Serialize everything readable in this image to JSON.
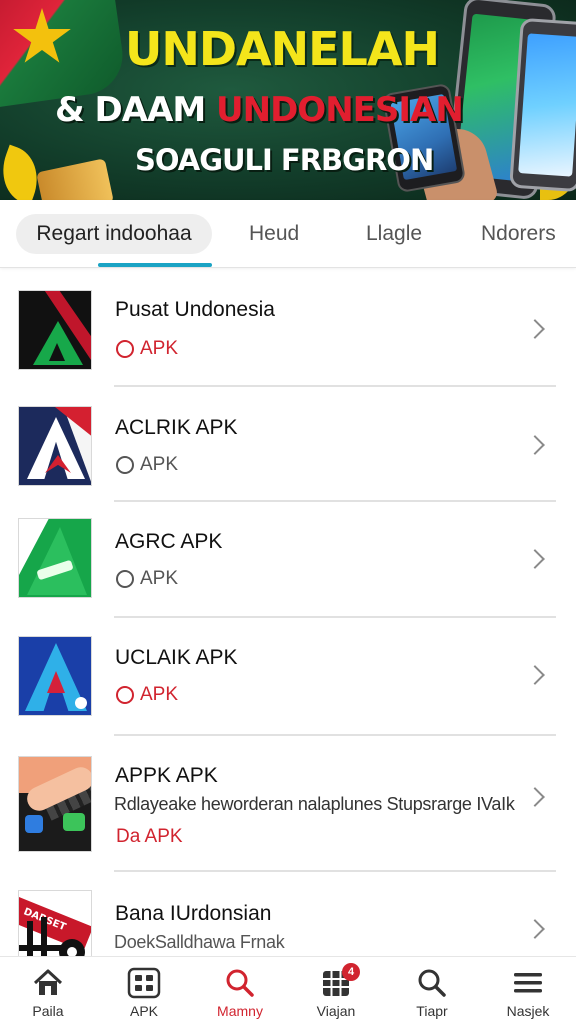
{
  "banner": {
    "title": "UNDANELAH",
    "line2_white": "& DAAM",
    "line2_red": " UNDONESIAN",
    "line3": "SOAGULI FRBGRON"
  },
  "tabs": [
    {
      "label": "Regart indoohaa",
      "active": true
    },
    {
      "label": "Heud",
      "active": false
    },
    {
      "label": "Llagle",
      "active": false
    },
    {
      "label": "Ndorers",
      "active": false
    }
  ],
  "accent_color": "#1aa3c4",
  "badge_red_color": "#d1242f",
  "items": [
    {
      "name": "Pusat Undonesia",
      "badge": "APK",
      "badge_style": "red",
      "icon": "red-green-triangle-logo"
    },
    {
      "name": "ACLRIK APK",
      "badge": "APK",
      "badge_style": "gray",
      "icon": "navy-red-a-logo"
    },
    {
      "name": "AGRC APK",
      "badge": "APK",
      "badge_style": "gray",
      "icon": "green-triangle-logo"
    },
    {
      "name": "UCLAIK APK",
      "badge": "APK",
      "badge_style": "red",
      "icon": "blue-a-logo"
    },
    {
      "name": "APPK APK",
      "desc": "Rdlayeake heworderan nalaplunes Stupsrarge IVaIk",
      "badge": "Da APK",
      "badge_style": "red-text",
      "icon": "keyboard-hand-thumbnail"
    },
    {
      "name": "Bana IUrdonsian",
      "desc": "DoekSalldhawa Frnak",
      "icon": "red-banner-logo",
      "thumb_text": "DARSET"
    }
  ],
  "bottom_nav": [
    {
      "label": "Paila",
      "icon": "home-icon",
      "active": false
    },
    {
      "label": "APK",
      "icon": "apps-grid-icon",
      "active": false
    },
    {
      "label": "Mamny",
      "icon": "search-icon",
      "active": true
    },
    {
      "label": "Viajan",
      "icon": "grid-icon",
      "active": false,
      "badge": "4"
    },
    {
      "label": "Tiapr",
      "icon": "search-icon",
      "active": false
    },
    {
      "label": "Nasjek",
      "icon": "menu-icon",
      "active": false
    }
  ]
}
